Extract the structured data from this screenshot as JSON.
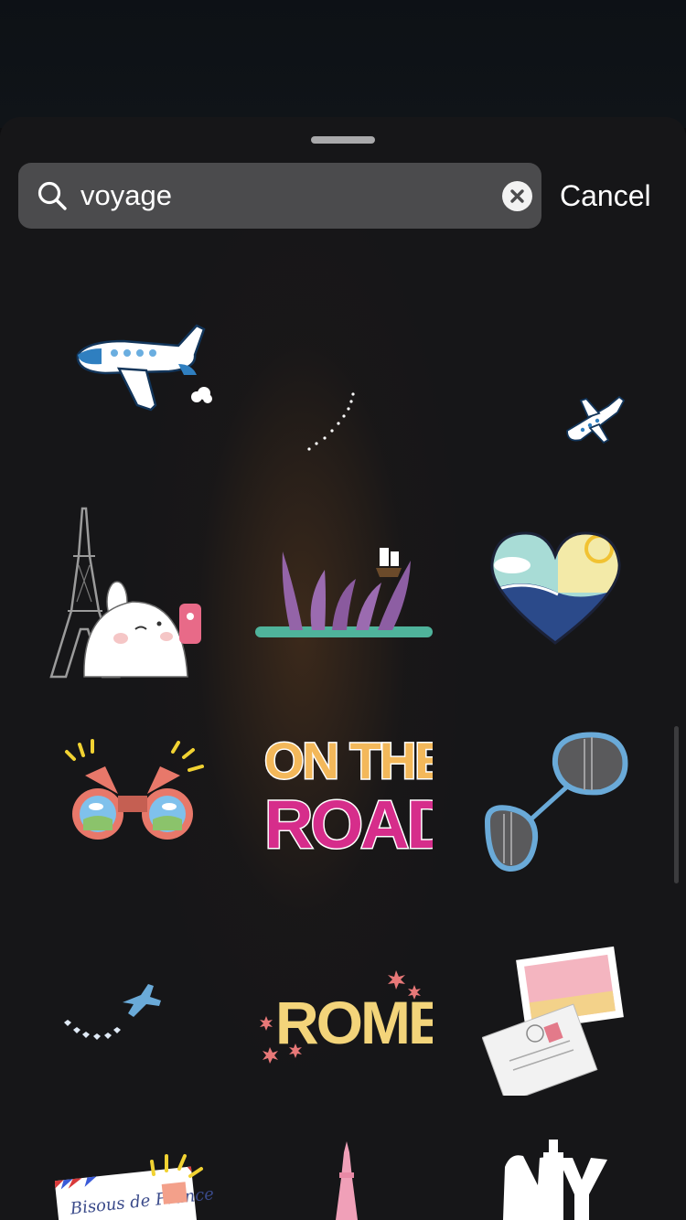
{
  "search": {
    "value": "voyage",
    "cancel_label": "Cancel"
  },
  "stickers": [
    {
      "name": "airplane",
      "icon": "airplane-icon"
    },
    {
      "name": "dotted-trail",
      "icon": "dotted-trail-icon"
    },
    {
      "name": "small-airplane",
      "icon": "small-airplane-icon"
    },
    {
      "name": "molang-eiffel-tower",
      "icon": "eiffel-tower-icon"
    },
    {
      "name": "kraken-ship",
      "icon": "kraken-icon"
    },
    {
      "name": "beach-heart",
      "icon": "heart-icon"
    },
    {
      "name": "binoculars",
      "icon": "binoculars-icon"
    },
    {
      "name": "on-the-road",
      "text_line1": "ON THE",
      "text_line2": "ROAD"
    },
    {
      "name": "sunglasses",
      "icon": "sunglasses-icon"
    },
    {
      "name": "plane-heart-trail",
      "icon": "plane-trail-icon"
    },
    {
      "name": "rome",
      "text": "ROME"
    },
    {
      "name": "postcards",
      "icon": "postcard-icon"
    },
    {
      "name": "bisous-de-france",
      "text": "Bisous de France"
    },
    {
      "name": "pink-tower",
      "icon": "tower-icon"
    },
    {
      "name": "ny",
      "icon": "ny-icon"
    }
  ],
  "colors": {
    "sheet": "#161618",
    "search_field": "#4b4b4d",
    "text": "#ffffff"
  }
}
